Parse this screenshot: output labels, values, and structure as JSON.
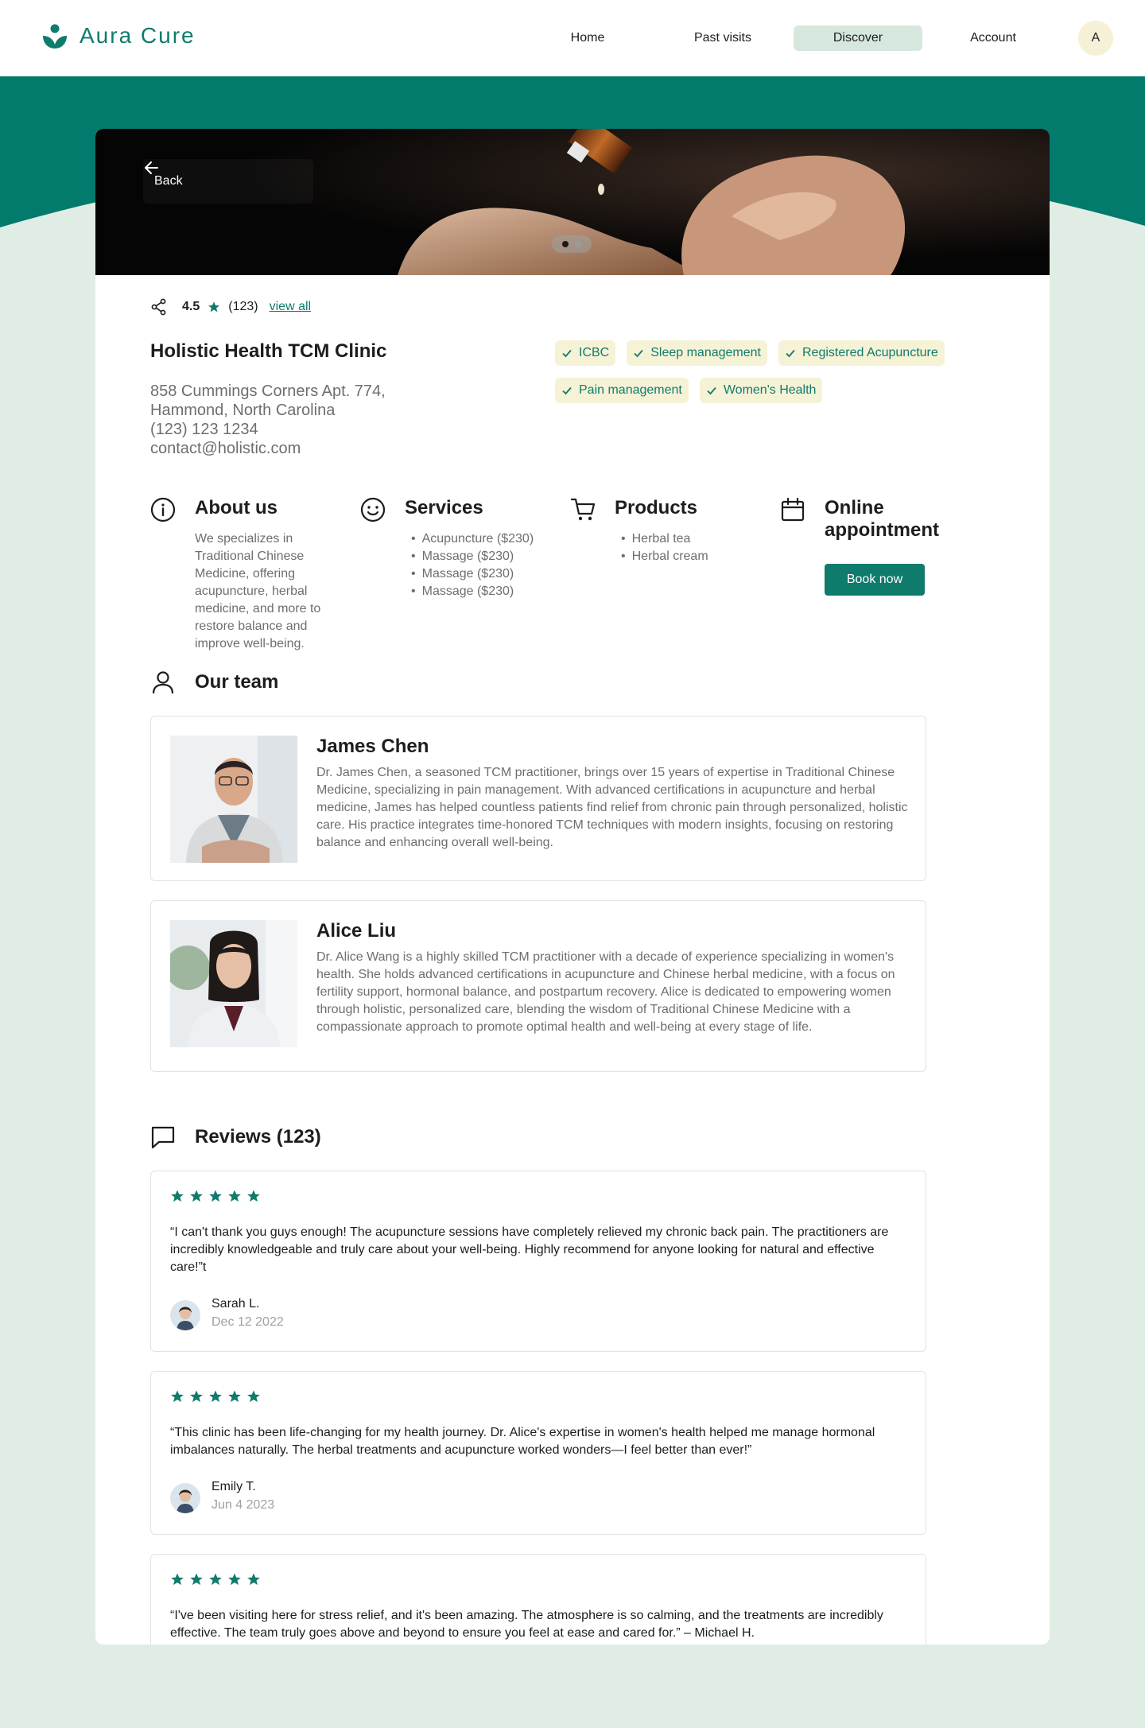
{
  "brand": {
    "name": "Aura Cure",
    "accent": "#0f7b6c",
    "band": "#027a6c",
    "background": "#e0ede5",
    "tag_bg": "#f6f2d6"
  },
  "nav": {
    "items": [
      {
        "label": "Home",
        "active": false
      },
      {
        "label": "Past visits",
        "active": false
      },
      {
        "label": "Discover",
        "active": true
      },
      {
        "label": "Account",
        "active": false
      }
    ],
    "avatar_initial": "A"
  },
  "hero": {
    "back_label": "Back",
    "slides": 2,
    "current_slide": 1
  },
  "clinic": {
    "rating": "4.5",
    "rating_count": "(123)",
    "view_all": "view all",
    "name": "Holistic Health TCM Clinic",
    "address_line1": "858 Cummings Corners Apt. 774,",
    "address_line2": "Hammond, North Carolina",
    "phone": "(123) 123 1234",
    "email": "contact@holistic.com",
    "tags": [
      "ICBC",
      "Sleep management",
      "Registered Acupuncture",
      "Pain management",
      "Women's Health"
    ]
  },
  "features": {
    "about": {
      "title": "About us",
      "text": "We specializes in Traditional Chinese Medicine, offering acupuncture, herbal medicine, and more to restore balance and improve well-being."
    },
    "services": {
      "title": "Services",
      "items": [
        "Acupuncture ($230)",
        "Massage ($230)",
        "Massage ($230)",
        "Massage ($230)"
      ]
    },
    "products": {
      "title": "Products",
      "items": [
        "Herbal tea",
        "Herbal cream"
      ]
    },
    "online": {
      "title": "Online appointment",
      "button": "Book now"
    }
  },
  "team": {
    "title": "Our team",
    "members": [
      {
        "name": "James Chen",
        "bio": "Dr. James Chen, a seasoned TCM practitioner, brings over 15 years of expertise in Traditional Chinese Medicine, specializing in pain management. With advanced certifications in acupuncture and herbal medicine, James has helped countless patients find relief from chronic pain through personalized, holistic care. His practice integrates time-honored TCM techniques with modern insights, focusing on restoring balance and enhancing overall well-being."
      },
      {
        "name": "Alice Liu",
        "bio": "Dr. Alice Wang is a highly skilled TCM practitioner with a decade of experience specializing in women's health. She holds advanced certifications in acupuncture and Chinese herbal medicine, with a focus on fertility support, hormonal balance, and postpartum recovery. Alice is dedicated to empowering women through holistic, personalized care, blending the wisdom of Traditional Chinese Medicine with a compassionate approach to promote optimal health and well-being at every stage of life."
      }
    ]
  },
  "reviews": {
    "title": "Reviews (123)",
    "items": [
      {
        "stars": 5,
        "text": "“I can't thank you guys enough! The acupuncture sessions have completely relieved my chronic back pain. The practitioners are incredibly knowledgeable and truly care about your well-being. Highly recommend for anyone looking for natural and effective care!”t",
        "author": "Sarah L.",
        "date": "Dec 12 2022"
      },
      {
        "stars": 5,
        "text": "“This clinic has been life-changing for my health journey. Dr. Alice's expertise in women's health helped me manage hormonal imbalances naturally. The herbal treatments and acupuncture worked wonders—I feel better than ever!”",
        "author": "Emily T.",
        "date": "Jun 4 2023"
      },
      {
        "stars": 5,
        "text": "“I've been visiting here for stress relief, and it's been amazing. The atmosphere is so calming, and the treatments are incredibly effective. The team truly goes above and beyond to ensure you feel at ease and cared for.” – Michael H."
      }
    ]
  }
}
